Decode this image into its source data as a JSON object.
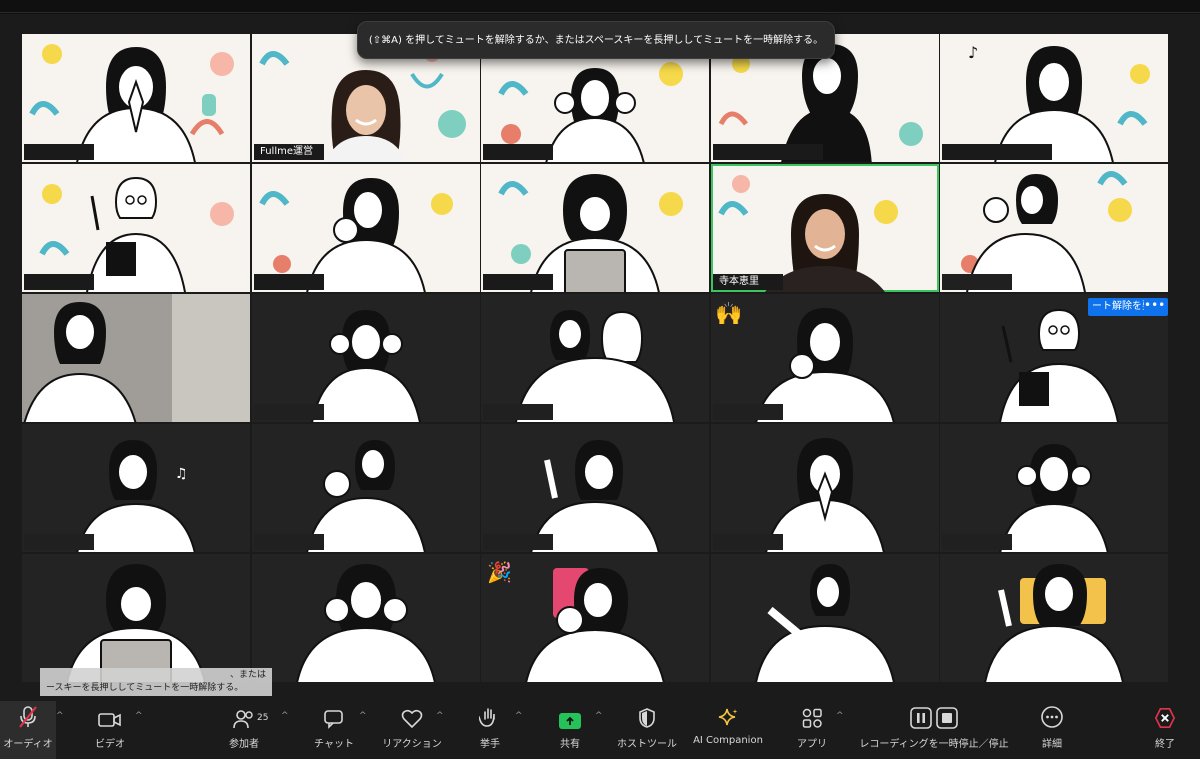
{
  "tooltip": {
    "text": "(⇧⌘A) を押してミュートを解除するか、またはスペースキーを長押ししてミュートを一時解除する。"
  },
  "participants": {
    "fullme": "Fullme運営",
    "teramoto": "寺本恵里"
  },
  "unmute_request": {
    "label": "ート解除を要請",
    "more": "•••"
  },
  "emoji": {
    "raised_hands": "🙌",
    "party": "🎉"
  },
  "subtitle": {
    "line1": "、または",
    "line2": "ースキーを長押ししてミュートを一時解除する。"
  },
  "toolbar": {
    "audio": "オーディオ",
    "video": "ビデオ",
    "participants": "参加者",
    "participants_count": "25",
    "chat": "チャット",
    "reaction": "リアクション",
    "raise_hand": "挙手",
    "share": "共有",
    "host_tools": "ホストツール",
    "ai_companion": "AI Companion",
    "apps": "アプリ",
    "recording": "レコーディングを一時停止／停止",
    "details": "詳細",
    "end": "終了"
  },
  "colors": {
    "accent_blue": "#0e72ed",
    "active_green": "#3ac55f",
    "share_green": "#25c25a",
    "mute_red": "#e0334a",
    "end_red": "#e0334a",
    "ai_yellow": "#f5c542"
  }
}
